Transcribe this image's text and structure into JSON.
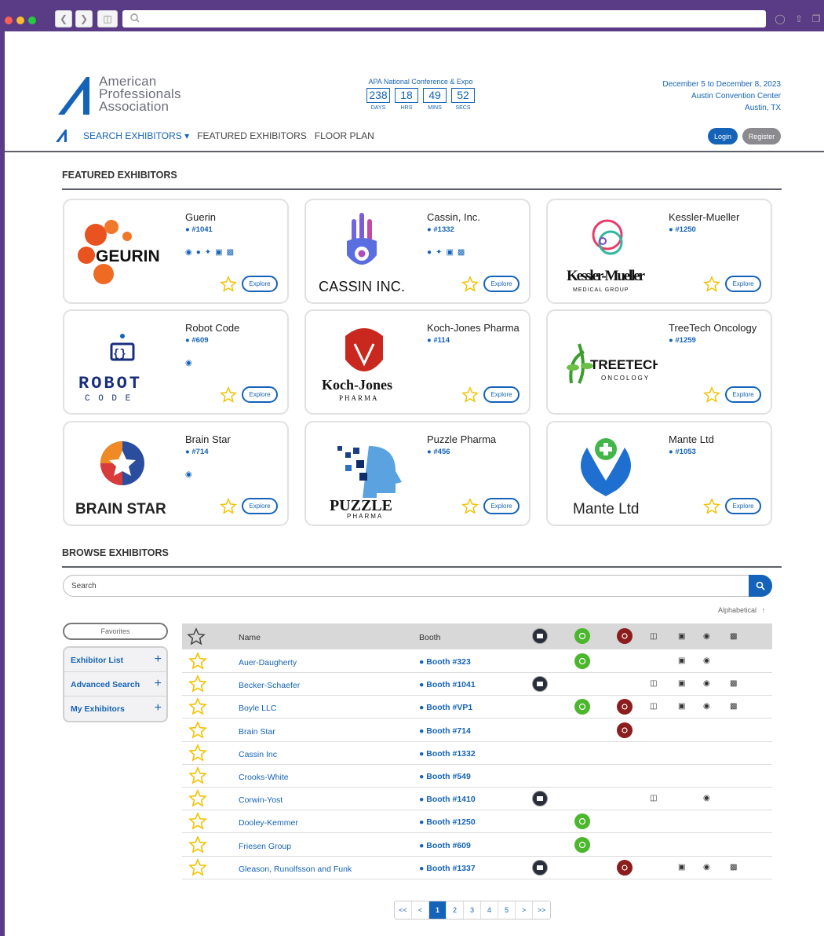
{
  "header": {
    "logo_lines": [
      "American",
      "Professionals",
      "Association"
    ],
    "countdown": {
      "title": "APA National Conference & Expo",
      "days": "238",
      "hrs": "18",
      "mins": "49",
      "secs": "52",
      "labels": [
        "DAYS",
        "HRS",
        "MINS",
        "SECS"
      ]
    },
    "dates": [
      "December 5 to December 8, 2023",
      "Austin Convention Center",
      "Austin, TX"
    ],
    "nav": {
      "search": "SEARCH EXHIBITORS",
      "featured": "FEATURED EXHIBITORS",
      "floor": "FLOOR PLAN"
    },
    "login": "Login",
    "register": "Register"
  },
  "featured": {
    "title": "FEATURED EXHIBITORS",
    "explore": "Explore",
    "cards": [
      {
        "name": "Guerin",
        "booth": "#1041",
        "logo_text": "GEURIN",
        "logo_sub": ""
      },
      {
        "name": "Cassin, Inc.",
        "booth": "#1332",
        "logo_text": "CASSIN INC.",
        "logo_sub": ""
      },
      {
        "name": "Kessler-Mueller",
        "booth": "#1250",
        "logo_text": "Kessler-Mueller",
        "logo_sub": "MEDICAL GROUP"
      },
      {
        "name": "Robot Code",
        "booth": "#609",
        "logo_text": "ROBOT",
        "logo_sub": "C O D E"
      },
      {
        "name": "Koch-Jones Pharma",
        "booth": "#114",
        "logo_text": "Koch-Jones",
        "logo_sub": "PHARMA"
      },
      {
        "name": "TreeTech Oncology",
        "booth": "#1259",
        "logo_text": "TREETECH",
        "logo_sub": "ONCOLOGY"
      },
      {
        "name": "Brain Star",
        "booth": "#714",
        "logo_text": "BRAIN STAR",
        "logo_sub": ""
      },
      {
        "name": "Puzzle Pharma",
        "booth": "#456",
        "logo_text": "PUZZLE",
        "logo_sub": "PHARMA"
      },
      {
        "name": "Mante Ltd",
        "booth": "#1053",
        "logo_text": "Mante Ltd",
        "logo_sub": ""
      }
    ]
  },
  "browse": {
    "title": "BROWSE EXHIBITORS",
    "search_placeholder": "Search",
    "sort": "Alphabetical",
    "favorites": "Favorites",
    "sidebar": [
      "Exhibitor List",
      "Advanced Search",
      "My Exhibitors"
    ],
    "col_name": "Name",
    "col_booth": "Booth",
    "rows": [
      {
        "name": "Auer-Daugherty",
        "booth": "Booth #323"
      },
      {
        "name": "Becker-Schaefer",
        "booth": "Booth #1041"
      },
      {
        "name": "Boyle LLC",
        "booth": "Booth #VP1"
      },
      {
        "name": "Brain Star",
        "booth": "Booth #714"
      },
      {
        "name": "Cassin Inc",
        "booth": "Booth #1332"
      },
      {
        "name": "Crooks-White",
        "booth": "Booth #549"
      },
      {
        "name": "Corwin-Yost",
        "booth": "Booth #1410"
      },
      {
        "name": "Dooley-Kemmer",
        "booth": "Booth #1250"
      },
      {
        "name": "Friesen Group",
        "booth": "Booth #609"
      },
      {
        "name": "Gleason, Runolfsson and Funk",
        "booth": "Booth #1337"
      }
    ],
    "pagination": [
      "<<",
      "<",
      "1",
      "2",
      "3",
      "4",
      "5",
      ">",
      ">>"
    ]
  }
}
